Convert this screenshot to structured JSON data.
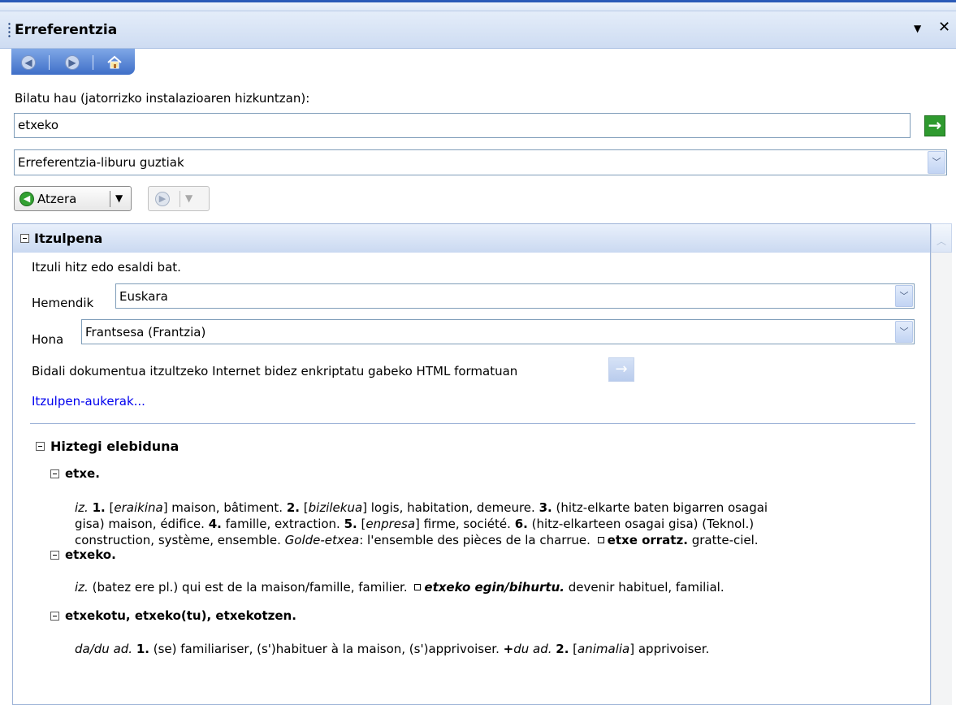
{
  "pane": {
    "title": "Erreferentzia",
    "menu_icon": "▼",
    "close_icon": "✕"
  },
  "nav": {
    "back_icon": "back-circle",
    "forward_icon": "forward-circle",
    "home_icon": "home"
  },
  "search": {
    "label": "Bilatu hau (jatorrizko instalazioaren hizkuntzan):",
    "value": "etxeko",
    "go_icon": "→"
  },
  "source_select": {
    "value": "Erreferentzia-liburu guztiak"
  },
  "toolbar": {
    "back_label": "Atzera"
  },
  "translation": {
    "title": "Itzulpena",
    "prompt": "Itzuli hitz edo esaldi bat.",
    "from_label": "Hemendik",
    "from_value": "Euskara",
    "to_label": "Hona",
    "to_value": "Frantsesa (Frantzia)",
    "send_text": "Bidali dokumentua itzultzeko Internet bidez enkriptatu gabeko HTML formatuan",
    "options_link": "Itzulpen-aukerak..."
  },
  "dictionary": {
    "title": "Hiztegi elebiduna",
    "entries": [
      {
        "head": "etxe.",
        "pos": "iz.",
        "n1": "1.",
        "t1a": "[",
        "t1b": "eraikina",
        "t1c": "] maison, bâtiment.",
        "n2": "2.",
        "t2b": "bizilekua",
        "t2c": "] logis, habitation, demeure.",
        "n3": "3.",
        "t3": "(hitz-elkarte baten bigarren osagai",
        "line2a": "gisa) maison, édifice.",
        "n4": "4.",
        "t4": "famille, extraction.",
        "n5": "5.",
        "t5b": "enpresa",
        "t5c": "] firme, société.",
        "n6": "6.",
        "t6": "(hitz-elkarteen osagai gisa) (Teknol.)",
        "line3a": "construction, système, ensemble.",
        "line3b": "Golde-etxea",
        "line3c": ": l'ensemble des pièces de la charrue.",
        "line3d": "etxe orratz.",
        "line3e": "gratte-ciel."
      },
      {
        "head": "etxeko.",
        "pos": "iz.",
        "t1": "(batez ere pl.) qui est de la maison/famille, familier.",
        "phrase": "etxeko egin/bihurtu.",
        "t2": "devenir habituel, familial."
      },
      {
        "head": "etxekotu, etxeko(tu), etxekotzen.",
        "pos": "da/du ad.",
        "n1": "1.",
        "t1": "(se) familiariser, (s')habituer à la maison, (s')apprivoiser.",
        "plus": "+",
        "pos2": "du ad.",
        "n2": "2.",
        "t2b": "animalia",
        "t2c": "] apprivoiser."
      }
    ]
  }
}
